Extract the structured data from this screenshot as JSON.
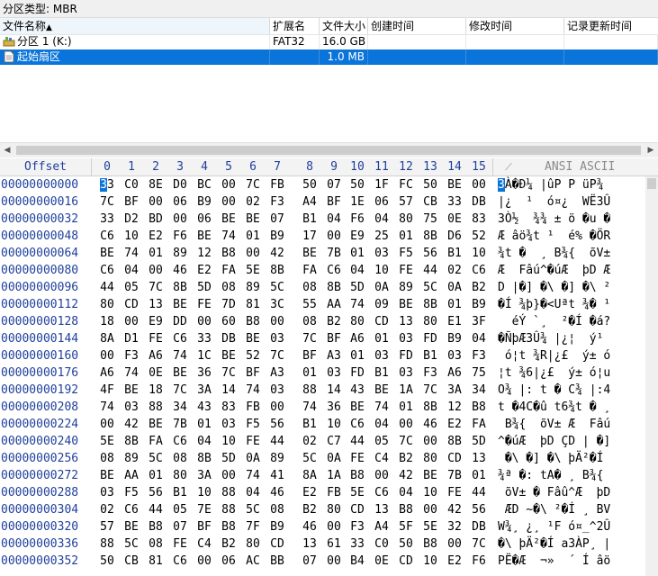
{
  "partition_type_label": "分区类型: MBR",
  "file_table": {
    "columns": {
      "name": "文件名称",
      "sort_indicator": "▲",
      "ext": "扩展名",
      "size": "文件大小",
      "created": "创建时间",
      "modified": "修改时间",
      "updated": "记录更新时间"
    },
    "rows": [
      {
        "name": "分区 1 (K:)",
        "ext": "FAT32",
        "size": "16.0 GB",
        "created": "",
        "modified": "",
        "updated": "",
        "icon": "partition-icon",
        "selected": false
      },
      {
        "name": "起始扇区",
        "ext": "",
        "size": "1.0 MB",
        "created": "",
        "modified": "",
        "updated": "",
        "icon": "file-icon",
        "selected": true
      }
    ]
  },
  "hex": {
    "offset_label": "Offset",
    "columns": [
      "0",
      "1",
      "2",
      "3",
      "4",
      "5",
      "6",
      "7",
      "8",
      "9",
      "10",
      "11",
      "12",
      "13",
      "14",
      "15"
    ],
    "ansi_label": "ANSI ASCII",
    "rows": [
      {
        "offset": "00000000000",
        "bytes": [
          "33",
          "C0",
          "8E",
          "D0",
          "BC",
          "00",
          "7C",
          "FB",
          "50",
          "07",
          "50",
          "1F",
          "FC",
          "50",
          "BE",
          "00"
        ],
        "ansi": "3À�Ð¼ |ûP P üP¾"
      },
      {
        "offset": "00000000016",
        "bytes": [
          "7C",
          "BF",
          "00",
          "06",
          "B9",
          "00",
          "02",
          "F3",
          "A4",
          "BF",
          "1E",
          "06",
          "57",
          "CB",
          "33",
          "DB"
        ],
        "ansi": "|¿  ¹  ó¤¿  WË3Û"
      },
      {
        "offset": "00000000032",
        "bytes": [
          "33",
          "D2",
          "BD",
          "00",
          "06",
          "BE",
          "BE",
          "07",
          "B1",
          "04",
          "F6",
          "04",
          "80",
          "75",
          "0E",
          "83"
        ],
        "ansi": "3Ò½  ¾¾ ± ö �u �"
      },
      {
        "offset": "00000000048",
        "bytes": [
          "C6",
          "10",
          "E2",
          "F6",
          "BE",
          "74",
          "01",
          "B9",
          "17",
          "00",
          "E9",
          "25",
          "01",
          "8B",
          "D6",
          "52"
        ],
        "ansi": "Æ âö¾t ¹  é% �ÖR"
      },
      {
        "offset": "00000000064",
        "bytes": [
          "BE",
          "74",
          "01",
          "89",
          "12",
          "B8",
          "00",
          "42",
          "BE",
          "7B",
          "01",
          "03",
          "F5",
          "56",
          "B1",
          "10"
        ],
        "ansi": "¾t �  ¸ B¾{  õV± "
      },
      {
        "offset": "00000000080",
        "bytes": [
          "C6",
          "04",
          "00",
          "46",
          "E2",
          "FA",
          "5E",
          "8B",
          "FA",
          "C6",
          "04",
          "10",
          "FE",
          "44",
          "02",
          "C6"
        ],
        "ansi": "Æ  Fâú^�úÆ  þD Æ"
      },
      {
        "offset": "00000000096",
        "bytes": [
          "44",
          "05",
          "7C",
          "8B",
          "5D",
          "08",
          "89",
          "5C",
          "08",
          "8B",
          "5D",
          "0A",
          "89",
          "5C",
          "0A",
          "B2"
        ],
        "ansi": "D |�] �\\ �] �\\ ²"
      },
      {
        "offset": "00000000112",
        "bytes": [
          "80",
          "CD",
          "13",
          "BE",
          "FE",
          "7D",
          "81",
          "3C",
          "55",
          "AA",
          "74",
          "09",
          "BE",
          "8B",
          "01",
          "B9"
        ],
        "ansi": "�Í ¾þ}�<Uªt ¾� ¹"
      },
      {
        "offset": "00000000128",
        "bytes": [
          "18",
          "00",
          "E9",
          "DD",
          "00",
          "60",
          "B8",
          "00",
          "08",
          "B2",
          "80",
          "CD",
          "13",
          "80",
          "E1",
          "3F"
        ],
        "ansi": "  éÝ `¸  ²�Í �á?"
      },
      {
        "offset": "00000000144",
        "bytes": [
          "8A",
          "D1",
          "FE",
          "C6",
          "33",
          "DB",
          "BE",
          "03",
          "7C",
          "BF",
          "A6",
          "01",
          "03",
          "FD",
          "B9",
          "04"
        ],
        "ansi": "�ÑþÆ3Û¾ |¿¦  ý¹ "
      },
      {
        "offset": "00000000160",
        "bytes": [
          "00",
          "F3",
          "A6",
          "74",
          "1C",
          "BE",
          "52",
          "7C",
          "BF",
          "A3",
          "01",
          "03",
          "FD",
          "B1",
          "03",
          "F3"
        ],
        "ansi": " ó¦t ¾R|¿£  ý± ó"
      },
      {
        "offset": "00000000176",
        "bytes": [
          "A6",
          "74",
          "0E",
          "BE",
          "36",
          "7C",
          "BF",
          "A3",
          "01",
          "03",
          "FD",
          "B1",
          "03",
          "F3",
          "A6",
          "75"
        ],
        "ansi": "¦t ¾6|¿£  ý± ó¦u"
      },
      {
        "offset": "00000000192",
        "bytes": [
          "4F",
          "BE",
          "18",
          "7C",
          "3A",
          "14",
          "74",
          "03",
          "88",
          "14",
          "43",
          "BE",
          "1A",
          "7C",
          "3A",
          "34"
        ],
        "ansi": "O¾ |: t � C¾ |:4"
      },
      {
        "offset": "00000000208",
        "bytes": [
          "74",
          "03",
          "88",
          "34",
          "43",
          "83",
          "FB",
          "00",
          "74",
          "36",
          "BE",
          "74",
          "01",
          "8B",
          "12",
          "B8"
        ],
        "ansi": "t �4C�û t6¾t � ¸"
      },
      {
        "offset": "00000000224",
        "bytes": [
          "00",
          "42",
          "BE",
          "7B",
          "01",
          "03",
          "F5",
          "56",
          "B1",
          "10",
          "C6",
          "04",
          "00",
          "46",
          "E2",
          "FA"
        ],
        "ansi": " B¾{  õV± Æ  Fâú"
      },
      {
        "offset": "00000000240",
        "bytes": [
          "5E",
          "8B",
          "FA",
          "C6",
          "04",
          "10",
          "FE",
          "44",
          "02",
          "C7",
          "44",
          "05",
          "7C",
          "00",
          "8B",
          "5D"
        ],
        "ansi": "^�úÆ  þD ÇD | �]"
      },
      {
        "offset": "00000000256",
        "bytes": [
          "08",
          "89",
          "5C",
          "08",
          "8B",
          "5D",
          "0A",
          "89",
          "5C",
          "0A",
          "FE",
          "C4",
          "B2",
          "80",
          "CD",
          "13"
        ],
        "ansi": " �\\ �] �\\ þÄ²�Í "
      },
      {
        "offset": "00000000272",
        "bytes": [
          "BE",
          "AA",
          "01",
          "80",
          "3A",
          "00",
          "74",
          "41",
          "8A",
          "1A",
          "B8",
          "00",
          "42",
          "BE",
          "7B",
          "01"
        ],
        "ansi": "¾ª �: tA� ¸ B¾{ "
      },
      {
        "offset": "00000000288",
        "bytes": [
          "03",
          "F5",
          "56",
          "B1",
          "10",
          "88",
          "04",
          "46",
          "E2",
          "FB",
          "5E",
          "C6",
          "04",
          "10",
          "FE",
          "44"
        ],
        "ansi": " õV± � Fâû^Æ  þD"
      },
      {
        "offset": "00000000304",
        "bytes": [
          "02",
          "C6",
          "44",
          "05",
          "7E",
          "88",
          "5C",
          "08",
          "B2",
          "80",
          "CD",
          "13",
          "B8",
          "00",
          "42",
          "56"
        ],
        "ansi": " ÆD ~�\\ ²�Í ¸ BV"
      },
      {
        "offset": "00000000320",
        "bytes": [
          "57",
          "BE",
          "B8",
          "07",
          "BF",
          "B8",
          "7F",
          "B9",
          "46",
          "00",
          "F3",
          "A4",
          "5F",
          "5E",
          "32",
          "DB"
        ],
        "ansi": "W¾¸ ¿¸ ¹F ó¤_^2Û"
      },
      {
        "offset": "00000000336",
        "bytes": [
          "88",
          "5C",
          "08",
          "FE",
          "C4",
          "B2",
          "80",
          "CD",
          "13",
          "61",
          "33",
          "C0",
          "50",
          "B8",
          "00",
          "7C"
        ],
        "ansi": "�\\ þÄ²�Í a3ÀP¸ |"
      },
      {
        "offset": "00000000352",
        "bytes": [
          "50",
          "CB",
          "81",
          "C6",
          "00",
          "06",
          "AC",
          "BB",
          "07",
          "00",
          "B4",
          "0E",
          "CD",
          "10",
          "E2",
          "F6"
        ],
        "ansi": "PË�Æ  ¬»  ´ Í âö"
      }
    ]
  }
}
